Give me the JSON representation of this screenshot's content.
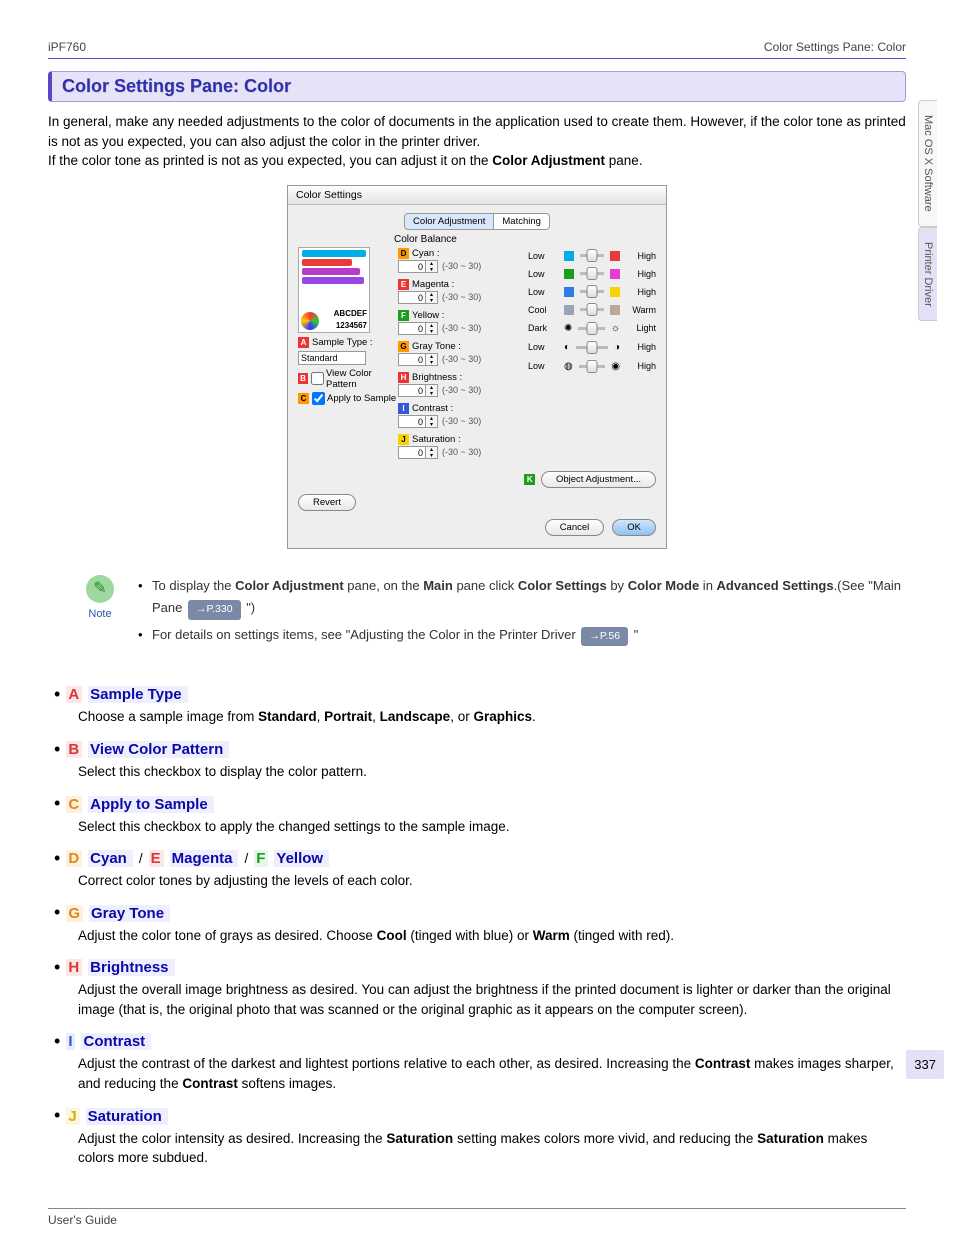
{
  "header": {
    "left": "iPF760",
    "right": "Color Settings Pane: Color"
  },
  "title": "Color Settings Pane: Color",
  "intro_html_parts": {
    "p1a": "In general, make any needed adjustments to the color of documents in the application used to create them. However, if the color tone as printed is not as you expected, you can also adjust the color in the printer driver.",
    "p2a": "If the color tone as printed is not as you expected, you can adjust it on the ",
    "p2b_bold": "Color Adjustment",
    "p2c": " pane."
  },
  "screenshot": {
    "window_title": "Color Settings",
    "tab_active": "Color Adjustment",
    "tab_other": "Matching",
    "group": "Color Balance",
    "preview_text": "ABCDEF",
    "preview_num": "1234567",
    "sample_type_label": "Sample Type :",
    "sample_type_value": "Standard",
    "view_pattern": "View Color Pattern",
    "apply_sample": "Apply to Sample",
    "params": [
      {
        "tag": "D",
        "tagClass": "tD",
        "name": "Cyan :",
        "lo": "Low",
        "hi": "High",
        "swL": "#00aee6",
        "swR": "#e73c3c"
      },
      {
        "tag": "E",
        "tagClass": "tE",
        "name": "Magenta :",
        "lo": "Low",
        "hi": "High",
        "swL": "#1b9e1b",
        "swR": "#e73ccf"
      },
      {
        "tag": "F",
        "tagClass": "tF",
        "name": "Yellow :",
        "lo": "Low",
        "hi": "High",
        "swL": "#2e7ae6",
        "swR": "#f5d400"
      },
      {
        "tag": "G",
        "tagClass": "tG",
        "name": "Gray Tone :",
        "lo": "Cool",
        "hi": "Warm",
        "swL": "#9aa4b8",
        "swR": "#b8a99a"
      },
      {
        "tag": "H",
        "tagClass": "tH",
        "name": "Brightness :",
        "lo": "Dark",
        "hi": "Light",
        "swL": "glyph:✺",
        "swR": "glyph:☼"
      },
      {
        "tag": "I",
        "tagClass": "tI",
        "name": "Contrast :",
        "lo": "Low",
        "hi": "High",
        "swL": "glyph:◐",
        "swR": "glyph:◑"
      },
      {
        "tag": "J",
        "tagClass": "tJ",
        "name": "Saturation :",
        "lo": "Low",
        "hi": "High",
        "swL": "glyph:◍",
        "swR": "glyph:◉"
      }
    ],
    "spin_value": "0",
    "spin_range": "(-30 ~ 30)",
    "obj_adj": "Object Adjustment...",
    "revert": "Revert",
    "cancel": "Cancel",
    "ok": "OK",
    "tagA": "A",
    "tagB": "B",
    "tagC": "C",
    "tagK": "K"
  },
  "note": {
    "label": "Note",
    "b1_a": "To display the ",
    "b1_b_bold": "Color Adjustment",
    "b1_c": " pane, on the ",
    "b1_d_bold": "Main",
    "b1_e": " pane click ",
    "b1_f_bold": "Color Settings",
    "b1_g": " by ",
    "b1_h_bold": "Color Mode",
    "b1_i": " in ",
    "b1_j_bold": "Advanced Settings",
    "b1_k": ".(See \"Main Pane ",
    "b1_link": "→P.330",
    "b1_m": " \")",
    "b2_a": "For details on settings items, see \"Adjusting the Color in the Printer Driver ",
    "b2_link": "→P.56",
    "b2_c": " \""
  },
  "items": {
    "A": {
      "letter": "A",
      "name": "Sample Type",
      "desc_pre": "Choose a sample image from ",
      "o1": "Standard",
      "o2": "Portrait",
      "o3": "Landscape",
      "o4": "Graphics",
      "desc_post": "."
    },
    "B": {
      "letter": "B",
      "name": "View Color Pattern",
      "desc": "Select this checkbox to display the color pattern."
    },
    "C": {
      "letter": "C",
      "name": "Apply to Sample",
      "desc": "Select this checkbox to apply the changed settings to the sample image."
    },
    "DEF": {
      "d": "D",
      "dn": "Cyan",
      "e": "E",
      "en": "Magenta",
      "f": "F",
      "fn": "Yellow",
      "slash": " / ",
      "desc": "Correct color tones by adjusting the levels of each color."
    },
    "G": {
      "letter": "G",
      "name": "Gray Tone",
      "desc_a": "Adjust the color tone of grays as desired. Choose ",
      "cool": "Cool",
      "desc_b": " (tinged with blue) or ",
      "warm": "Warm",
      "desc_c": " (tinged with red)."
    },
    "H": {
      "letter": "H",
      "name": "Brightness",
      "desc": "Adjust the overall image brightness as desired. You can adjust the brightness if the printed document is lighter or darker than the original image (that is, the original photo that was scanned or the original graphic as it appears on the computer screen)."
    },
    "I": {
      "letter": "I",
      "name": "Contrast",
      "desc_a": "Adjust the contrast of the darkest and lightest portions relative to each other, as desired. Increasing the ",
      "c1": "Contrast",
      "desc_b": " makes images sharper, and reducing the ",
      "c2": "Contrast",
      "desc_c": " softens images."
    },
    "J": {
      "letter": "J",
      "name": "Saturation",
      "desc_a": "Adjust the color intensity as desired. Increasing the ",
      "s1": "Saturation",
      "desc_b": " setting makes colors more vivid, and reducing the ",
      "s2": "Saturation",
      "desc_c": " makes colors more subdued."
    }
  },
  "sidebar": {
    "t1": "Mac OS X Software",
    "t2": "Printer Driver"
  },
  "page_number": "337",
  "footer": "User's Guide"
}
